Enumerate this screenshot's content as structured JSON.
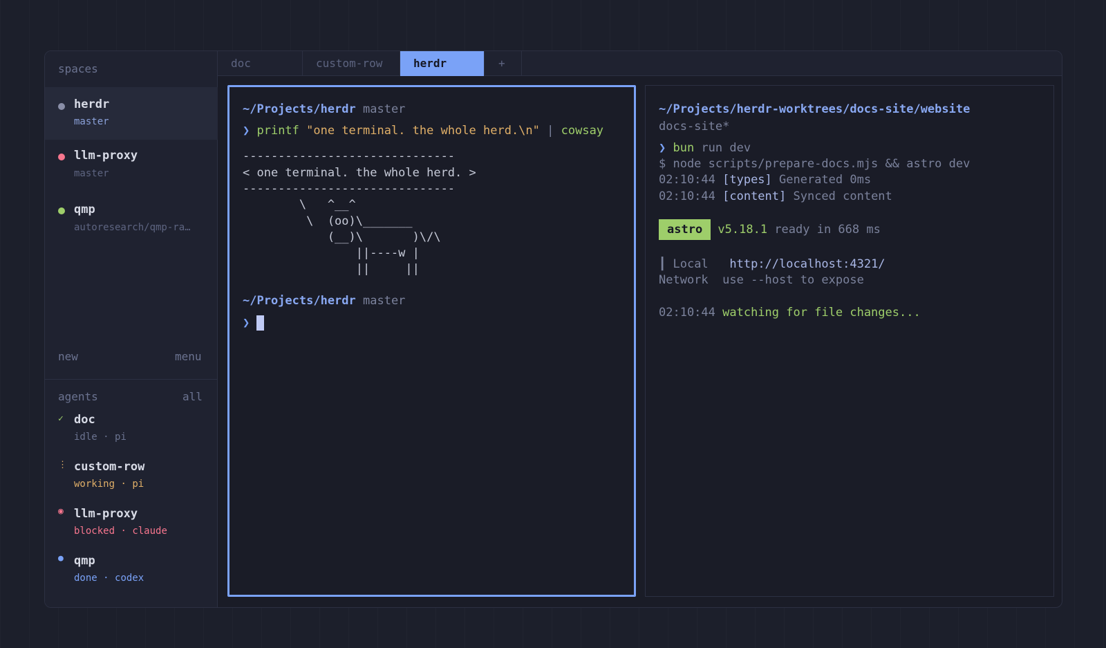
{
  "sidebar": {
    "spaces_heading": "spaces",
    "spaces": [
      {
        "name": "herdr",
        "branch": "master",
        "dot_color": "#8a8fa8",
        "active": true
      },
      {
        "name": "llm-proxy",
        "branch": "master",
        "dot_color": "#f7768e",
        "active": false
      },
      {
        "name": "qmp",
        "branch": "autoresearch/qmp-ra…",
        "dot_color": "#9ece6a",
        "active": false
      }
    ],
    "new_label": "new",
    "menu_label": "menu",
    "agents_heading": "agents",
    "agents_all_label": "all",
    "agents": [
      {
        "name": "doc",
        "icon": "✓",
        "icon_name": "check-icon",
        "state": "idle",
        "sep": " · ",
        "tool": "pi",
        "color": "#6b7390",
        "icon_color": "#9ece6a"
      },
      {
        "name": "custom-row",
        "icon": "⋮",
        "icon_name": "working-spinner-icon",
        "state": "working",
        "sep": " · ",
        "tool": "pi",
        "color": "#e0af68",
        "icon_color": "#e0af68"
      },
      {
        "name": "llm-proxy",
        "icon": "◉",
        "icon_name": "blocked-icon",
        "state": "blocked",
        "sep": " · ",
        "tool": "claude",
        "color": "#f7768e",
        "icon_color": "#f7768e"
      },
      {
        "name": "qmp",
        "icon": "●",
        "icon_name": "done-dot-icon",
        "state": "done",
        "sep": " · ",
        "tool": "codex",
        "color": "#7aa2f7",
        "icon_color": "#7aa2f7"
      }
    ]
  },
  "tabs": [
    {
      "label": "doc",
      "active": false
    },
    {
      "label": "custom-row",
      "active": false
    },
    {
      "label": "herdr",
      "active": true
    },
    {
      "label": "+",
      "active": false
    }
  ],
  "left_pane": {
    "path": "~/Projects/herdr",
    "branch": " master",
    "prompt": "❯ ",
    "cmd_printf": "printf ",
    "cmd_string": "\"one terminal. the whole herd.\\n\"",
    "cmd_pipe": " | ",
    "cmd_cowsay": "cowsay",
    "cow_lines": [
      "------------------------------",
      "< one terminal. the whole herd. >",
      "------------------------------",
      "        \\   ^__^",
      "         \\  (oo)\\_______",
      "            (__)\\       )\\/\\",
      "                ||----w |",
      "                ||     ||"
    ],
    "path2": "~/Projects/herdr",
    "branch2": " master",
    "prompt2": "❯ "
  },
  "right_pane": {
    "path": "~/Projects/herdr-worktrees/docs-site/website",
    "branch": "docs-site*",
    "prompt": "❯ ",
    "cmd_bun": "bun",
    "cmd_rest": " run dev",
    "line_node": "$ node scripts/prepare-docs.mjs && astro dev",
    "log1_time": "02:10:44 ",
    "log1_tag": "[types]",
    "log1_msg": " Generated 0ms",
    "log2_time": "02:10:44 ",
    "log2_tag": "[content]",
    "log2_msg": " Synced content",
    "astro_badge": "astro",
    "astro_version": " v5.18.1",
    "astro_ready": " ready in 668 ms",
    "local_bar": "┃",
    "local_label": " Local   ",
    "local_url": "http://localhost:4321/",
    "network_label": "Network  ",
    "network_msg": "use --host to expose",
    "watch_time": "02:10:44 ",
    "watch_msg": "watching for file changes..."
  }
}
